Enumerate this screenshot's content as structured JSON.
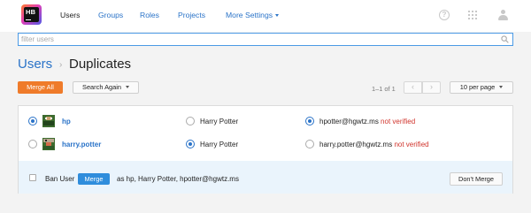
{
  "logo": {
    "text": "HB"
  },
  "nav": {
    "items": [
      {
        "label": "Users",
        "active": true
      },
      {
        "label": "Groups"
      },
      {
        "label": "Roles"
      },
      {
        "label": "Projects"
      },
      {
        "label": "More Settings",
        "dropdown": true
      }
    ],
    "help_symbol": "?",
    "icons": [
      "help-icon",
      "apps-grid-icon",
      "user-account-icon"
    ]
  },
  "search": {
    "placeholder": "filter users",
    "value": ""
  },
  "breadcrumb": {
    "parent": "Users",
    "separator": "›",
    "title": "Duplicates"
  },
  "toolbar": {
    "merge_all": "Merge All",
    "search_again": "Search Again",
    "page_info": "1–1 of 1",
    "prev": "‹",
    "next": "›",
    "per_page": "10 per page"
  },
  "duplicates": [
    {
      "username": "hp",
      "username_selected": true,
      "full_name": "Harry Potter",
      "full_name_selected": false,
      "email": "hpotter@hgwtz.ms",
      "email_selected": true,
      "email_status": "not verified"
    },
    {
      "username": "harry.potter",
      "username_selected": false,
      "full_name": "Harry Potter",
      "full_name_selected": true,
      "email": "harry.potter@hgwtz.ms",
      "email_selected": false,
      "email_status": "not verified"
    }
  ],
  "footer": {
    "ban_user": "Ban User",
    "merge": "Merge",
    "merge_as": "as hp, Harry Potter, hpotter@hgwtz.ms",
    "dont_merge": "Don't Merge"
  },
  "colors": {
    "accent": "#2a73c8",
    "merge_all": "#ef7b2a",
    "merge": "#2f8ddc",
    "not_verified": "#d0342c"
  }
}
